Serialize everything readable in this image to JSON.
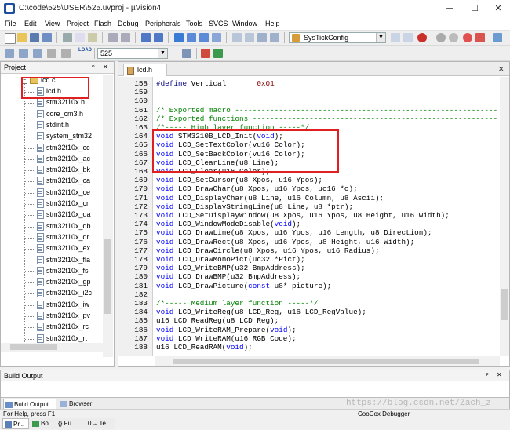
{
  "window": {
    "title": "C:\\code\\525\\USER\\525.uvproj - µVision4",
    "minimize": "─",
    "maximize": "☐",
    "close": "✕"
  },
  "menu": [
    "File",
    "Edit",
    "View",
    "Project",
    "Flash",
    "Debug",
    "Peripherals",
    "Tools",
    "SVCS",
    "Window",
    "Help"
  ],
  "toolbar1": {
    "function_combo": "SysTickConfig"
  },
  "toolbar2": {
    "target_label": "LOAD",
    "target_combo": "525"
  },
  "project": {
    "title": "Project",
    "folder": "lcd.c",
    "files": [
      "lcd.h",
      "stm32f10x.h",
      "core_cm3.h",
      "stdint.h",
      "system_stm32",
      "stm32f10x_cc",
      "stm32f10x_ac",
      "stm32f10x_bk",
      "stm32f10x_ca",
      "stm32f10x_ce",
      "stm32f10x_cr",
      "stm32f10x_da",
      "stm32f10x_db",
      "stm32f10x_dr",
      "stm32f10x_ex",
      "stm32f10x_fla",
      "stm32f10x_fsi",
      "stm32f10x_gp",
      "stm32f10x_i2c",
      "stm32f10x_iw",
      "stm32f10x_pv",
      "stm32f10x_rc",
      "stm32f10x_rt"
    ],
    "tabs": [
      "Pr...",
      "Bo",
      "{} Fu...",
      "0→ Te..."
    ]
  },
  "editor": {
    "tab": "lcd.h",
    "close": "✕",
    "lines": [
      {
        "n": "158",
        "segs": [
          {
            "c": "pp",
            "t": "#define"
          },
          {
            "c": "",
            "t": " Vertical       "
          },
          {
            "c": "num",
            "t": "0x01"
          }
        ]
      },
      {
        "n": "159",
        "segs": []
      },
      {
        "n": "160",
        "segs": []
      },
      {
        "n": "161",
        "segs": [
          {
            "c": "cm",
            "t": "/* Exported macro ------------------------------------------------------------"
          }
        ]
      },
      {
        "n": "162",
        "segs": [
          {
            "c": "cm",
            "t": "/* Exported functions --------------------------------------------------------"
          }
        ]
      },
      {
        "n": "163",
        "segs": [
          {
            "c": "cm",
            "t": "/*----- High layer function -----*/"
          }
        ]
      },
      {
        "n": "164",
        "segs": [
          {
            "c": "kw",
            "t": "void"
          },
          {
            "c": "",
            "t": " STM3210B_LCD_Init("
          },
          {
            "c": "kw",
            "t": "void"
          },
          {
            "c": "",
            "t": ");"
          }
        ]
      },
      {
        "n": "165",
        "segs": [
          {
            "c": "kw",
            "t": "void"
          },
          {
            "c": "",
            "t": " LCD_SetTextColor(vu16 Color);"
          }
        ]
      },
      {
        "n": "166",
        "segs": [
          {
            "c": "kw",
            "t": "void"
          },
          {
            "c": "",
            "t": " LCD_SetBackColor(vu16 Color);"
          }
        ]
      },
      {
        "n": "167",
        "segs": [
          {
            "c": "kw",
            "t": "void"
          },
          {
            "c": "",
            "t": " LCD_ClearLine(u8 Line);"
          }
        ]
      },
      {
        "n": "168",
        "segs": [
          {
            "c": "kw",
            "t": "void"
          },
          {
            "c": "",
            "t": " LCD_Clear(u16 Color);"
          }
        ]
      },
      {
        "n": "169",
        "segs": [
          {
            "c": "kw",
            "t": "void"
          },
          {
            "c": "",
            "t": " LCD_SetCursor(u8 Xpos, u16 Ypos);"
          }
        ]
      },
      {
        "n": "170",
        "segs": [
          {
            "c": "kw",
            "t": "void"
          },
          {
            "c": "",
            "t": " LCD_DrawChar(u8 Xpos, u16 Ypos, uc16 *c);"
          }
        ]
      },
      {
        "n": "171",
        "segs": [
          {
            "c": "kw",
            "t": "void"
          },
          {
            "c": "",
            "t": " LCD_DisplayChar(u8 Line, u16 Column, u8 Ascii);"
          }
        ]
      },
      {
        "n": "172",
        "segs": [
          {
            "c": "kw",
            "t": "void"
          },
          {
            "c": "",
            "t": " LCD_DisplayStringLine(u8 Line, u8 *ptr);"
          }
        ]
      },
      {
        "n": "173",
        "segs": [
          {
            "c": "kw",
            "t": "void"
          },
          {
            "c": "",
            "t": " LCD_SetDisplayWindow(u8 Xpos, u16 Ypos, u8 Height, u16 Width);"
          }
        ]
      },
      {
        "n": "174",
        "segs": [
          {
            "c": "kw",
            "t": "void"
          },
          {
            "c": "",
            "t": " LCD_WindowModeDisable("
          },
          {
            "c": "kw",
            "t": "void"
          },
          {
            "c": "",
            "t": ");"
          }
        ]
      },
      {
        "n": "175",
        "segs": [
          {
            "c": "kw",
            "t": "void"
          },
          {
            "c": "",
            "t": " LCD_DrawLine(u8 Xpos, u16 Ypos, u16 Length, u8 Direction);"
          }
        ]
      },
      {
        "n": "176",
        "segs": [
          {
            "c": "kw",
            "t": "void"
          },
          {
            "c": "",
            "t": " LCD_DrawRect(u8 Xpos, u16 Ypos, u8 Height, u16 Width);"
          }
        ]
      },
      {
        "n": "177",
        "segs": [
          {
            "c": "kw",
            "t": "void"
          },
          {
            "c": "",
            "t": " LCD_DrawCircle(u8 Xpos, u16 Ypos, u16 Radius);"
          }
        ]
      },
      {
        "n": "178",
        "segs": [
          {
            "c": "kw",
            "t": "void"
          },
          {
            "c": "",
            "t": " LCD_DrawMonoPict(uc32 *Pict);"
          }
        ]
      },
      {
        "n": "179",
        "segs": [
          {
            "c": "kw",
            "t": "void"
          },
          {
            "c": "",
            "t": " LCD_WriteBMP(u32 BmpAddress);"
          }
        ]
      },
      {
        "n": "180",
        "segs": [
          {
            "c": "kw",
            "t": "void"
          },
          {
            "c": "",
            "t": " LCD_DrawBMP(u32 BmpAddress);"
          }
        ]
      },
      {
        "n": "181",
        "segs": [
          {
            "c": "kw",
            "t": "void"
          },
          {
            "c": "",
            "t": " LCD_DrawPicture("
          },
          {
            "c": "kw",
            "t": "const"
          },
          {
            "c": "",
            "t": " u8* picture);"
          }
        ]
      },
      {
        "n": "182",
        "segs": []
      },
      {
        "n": "183",
        "segs": [
          {
            "c": "cm",
            "t": "/*----- Medium layer function -----*/"
          }
        ]
      },
      {
        "n": "184",
        "segs": [
          {
            "c": "kw",
            "t": "void"
          },
          {
            "c": "",
            "t": " LCD_WriteReg(u8 LCD_Reg, u16 LCD_RegValue);"
          }
        ]
      },
      {
        "n": "185",
        "segs": [
          {
            "c": "",
            "t": "u16 LCD_ReadReg(u8 LCD_Reg);"
          }
        ]
      },
      {
        "n": "186",
        "segs": [
          {
            "c": "kw",
            "t": "void"
          },
          {
            "c": "",
            "t": " LCD_WriteRAM_Prepare("
          },
          {
            "c": "kw",
            "t": "void"
          },
          {
            "c": "",
            "t": ");"
          }
        ]
      },
      {
        "n": "187",
        "segs": [
          {
            "c": "kw",
            "t": "void"
          },
          {
            "c": "",
            "t": " LCD_WriteRAM(u16 RGB_Code);"
          }
        ]
      },
      {
        "n": "188",
        "segs": [
          {
            "c": "",
            "t": "u16 LCD_ReadRAM("
          },
          {
            "c": "kw",
            "t": "void"
          },
          {
            "c": "",
            "t": ");"
          }
        ]
      }
    ]
  },
  "build_output": {
    "title": "Build Output",
    "pin": "ᵠ",
    "close": "✕",
    "tabs": [
      "Build Output",
      "Browser"
    ]
  },
  "status": {
    "help": "For Help, press F1",
    "debugger": "CooCox Debugger",
    "watermark": "https://blog.csdn.net/Zach_z"
  },
  "colors": {
    "highlight": "#e02020",
    "keyword": "#0000ff",
    "comment": "#008000"
  }
}
